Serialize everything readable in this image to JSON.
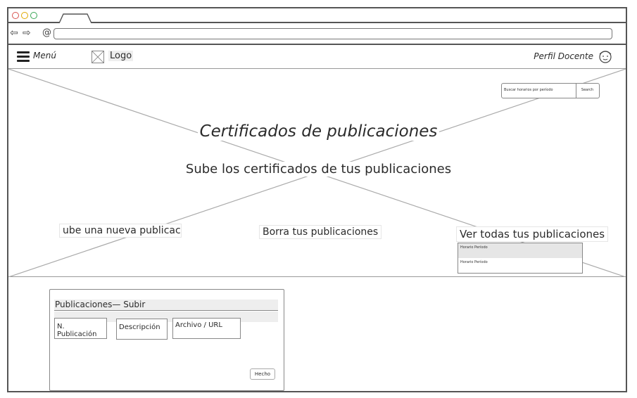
{
  "header": {
    "menu_label": "Menú",
    "logo_label": "Logo",
    "profile_label": "Perfil Docente"
  },
  "search": {
    "placeholder": "Buscar horarios por período",
    "button_label": "Search"
  },
  "hero": {
    "title": "Certificados de publicaciones",
    "subtitle": "Sube los certificados de tus publicaciones",
    "links": {
      "upload": "ube una nueva publicació",
      "delete": "Borra tus publicaciones",
      "view_all": "Ver todas tus publicaciones"
    },
    "dropdown_items": [
      "Horario Período",
      "Horario Período"
    ]
  },
  "upload_card": {
    "title": "Publicaciones— Subir",
    "fields": [
      "N. Publicación",
      "Descripción",
      "Archivo / URL"
    ],
    "done_label": "Hecho"
  }
}
